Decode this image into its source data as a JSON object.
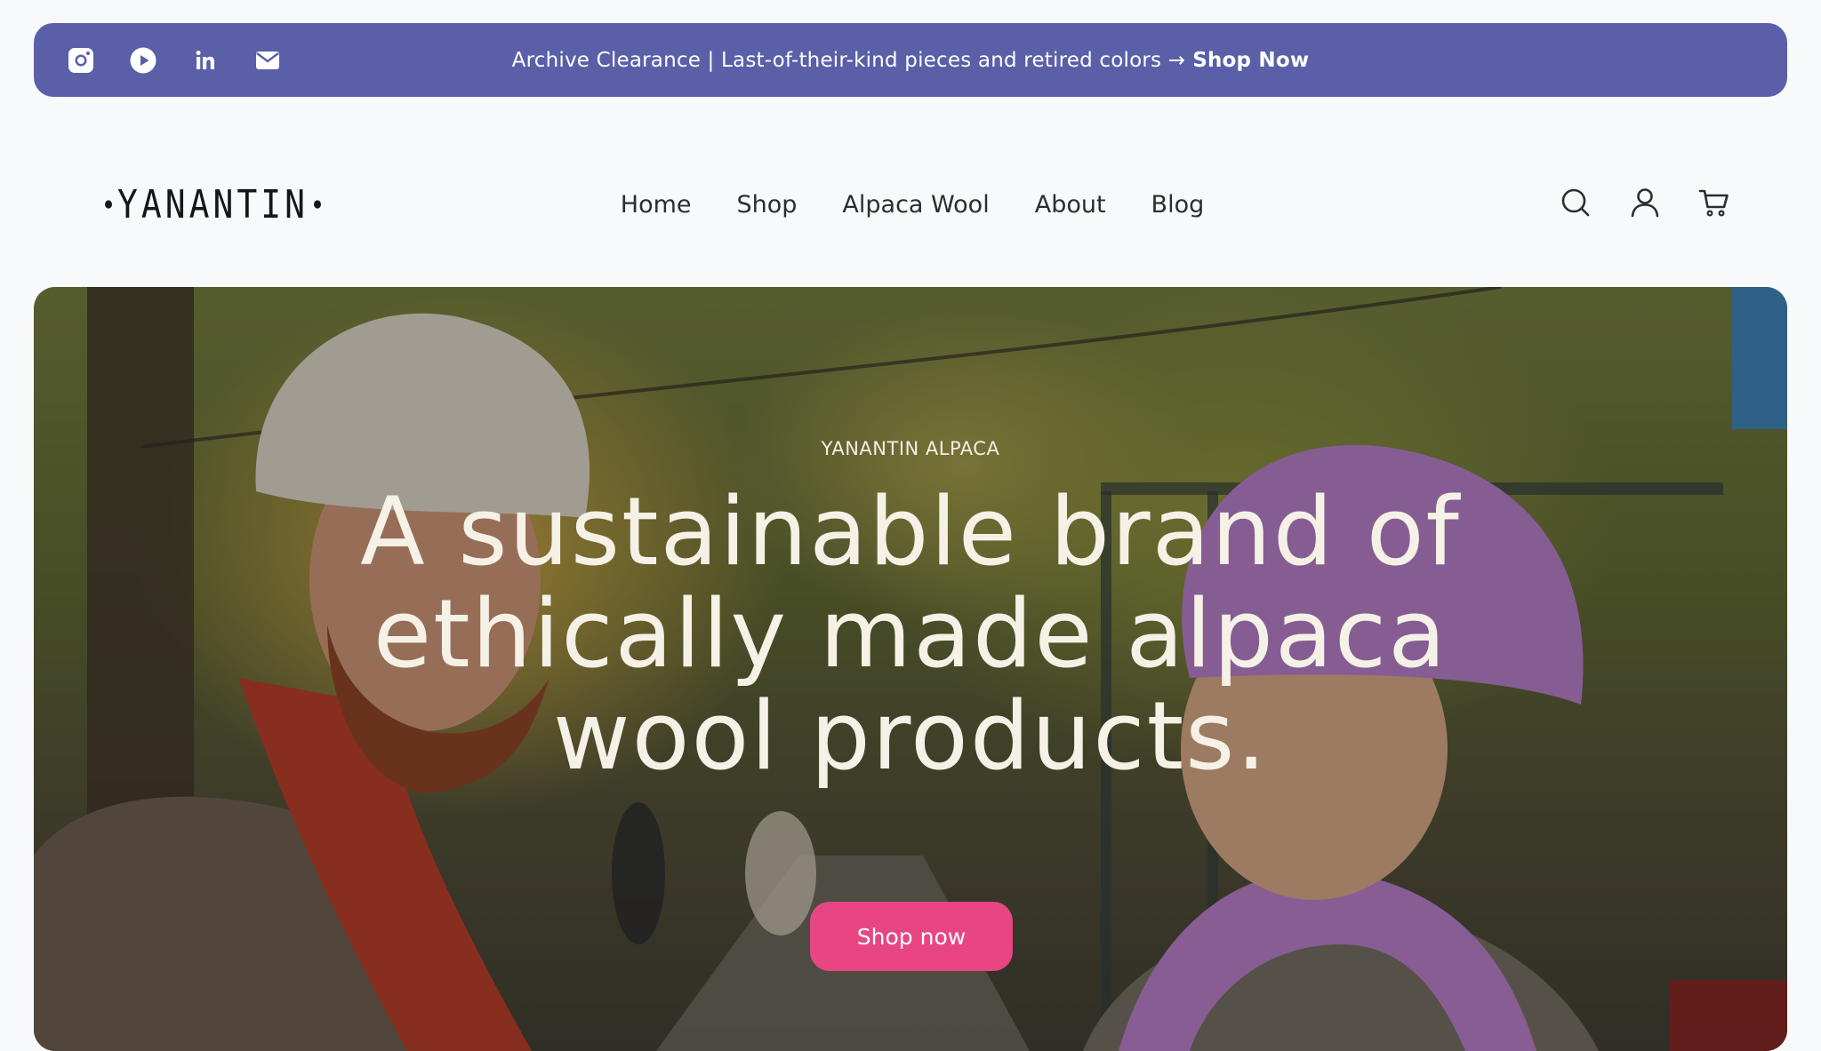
{
  "announcement": {
    "text": "Archive Clearance | Last-of-their-kind pieces and retired colors →",
    "cta": "Shop Now",
    "background": "#5a5fa8",
    "social_icons": [
      "instagram-icon",
      "youtube-icon",
      "linkedin-icon",
      "email-icon"
    ]
  },
  "header": {
    "logo": "YANANTIN",
    "nav": [
      "Home",
      "Shop",
      "Alpaca Wool",
      "About",
      "Blog"
    ],
    "icons": [
      "search-icon",
      "account-icon",
      "cart-icon"
    ]
  },
  "hero": {
    "eyebrow": "YANANTIN ALPACA",
    "title": "A sustainable brand of ethically made alpaca wool products.",
    "cta": "Shop now",
    "cta_color": "#e74683"
  }
}
